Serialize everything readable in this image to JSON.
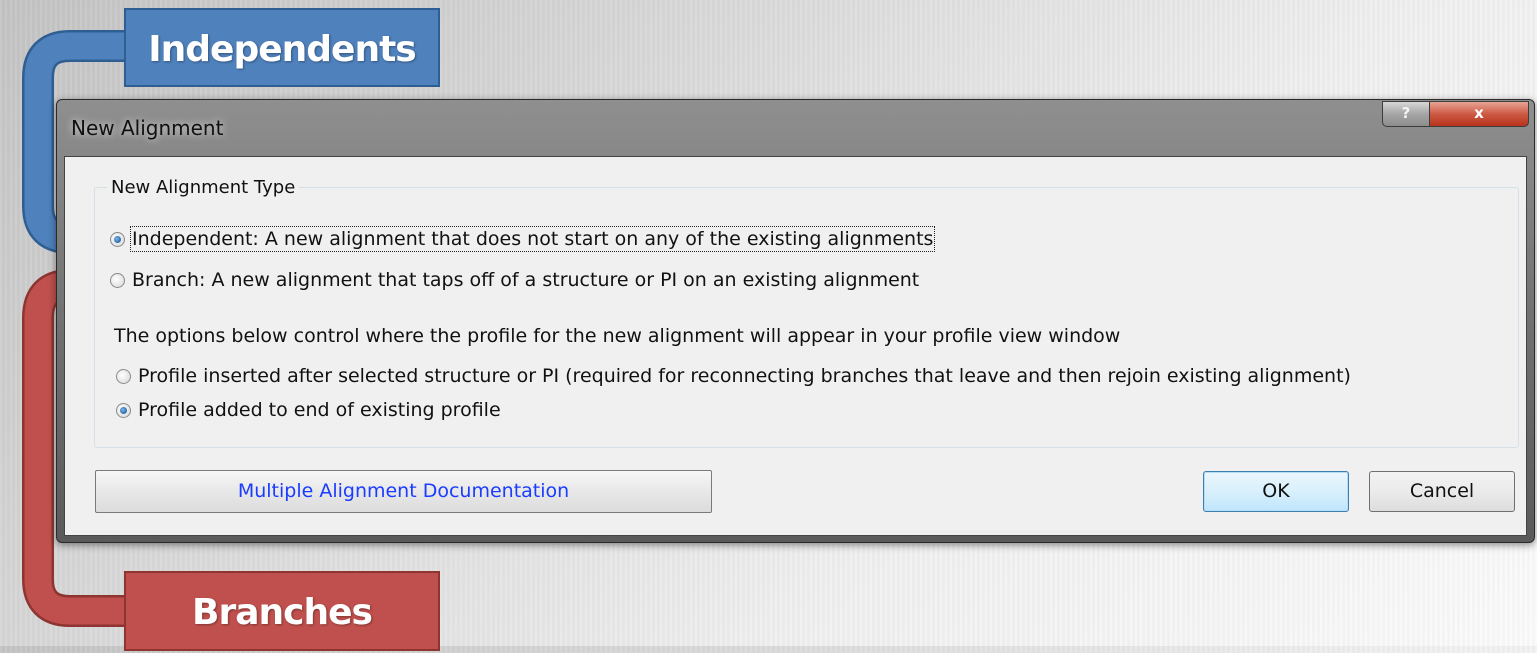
{
  "callouts": {
    "independents": "Independents",
    "branches": "Branches"
  },
  "dialog": {
    "title": "New Alignment",
    "help_label": "?",
    "close_label": "x",
    "group_title": "New Alignment Type",
    "type_options": [
      {
        "label": "Independent: A new alignment that does not start on any of the existing alignments",
        "checked": true
      },
      {
        "label": "Branch: A new alignment that taps off of a structure or PI on an existing alignment",
        "checked": false
      }
    ],
    "profile_info": "The options below control where the profile for the new alignment will appear in your profile view window",
    "profile_options": [
      {
        "label": "Profile inserted after selected structure or PI (required for reconnecting branches that leave and then rejoin existing alignment)",
        "checked": false
      },
      {
        "label": "Profile added to end of existing profile",
        "checked": true
      }
    ],
    "doc_button": "Multiple Alignment Documentation",
    "ok_button": "OK",
    "cancel_button": "Cancel"
  },
  "colors": {
    "callout_blue": "#4f81bd",
    "callout_red": "#c0504d",
    "link_blue": "#1a3cff"
  }
}
